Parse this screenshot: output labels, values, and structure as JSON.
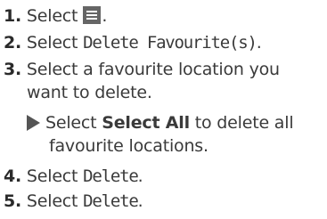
{
  "steps": [
    {
      "num": "1.",
      "pre": "Select",
      "post": "."
    },
    {
      "num": "2.",
      "pre": "Select",
      "term": "Delete Favourite(s)",
      "post": "."
    },
    {
      "num": "3.",
      "line1": "Select a favourite location you",
      "line2": "want to delete."
    },
    {
      "num": "4.",
      "pre": "Select",
      "term": "Delete",
      "post": "."
    },
    {
      "num": "5.",
      "pre": "Select",
      "term": "Delete",
      "post": "."
    }
  ],
  "substep": {
    "pre": "Select",
    "term": "Select All",
    "line1_post": "to delete all",
    "line2": "favourite locations."
  },
  "icons": {
    "menu": "menu-icon",
    "arrow": "arrow-right-icon"
  }
}
